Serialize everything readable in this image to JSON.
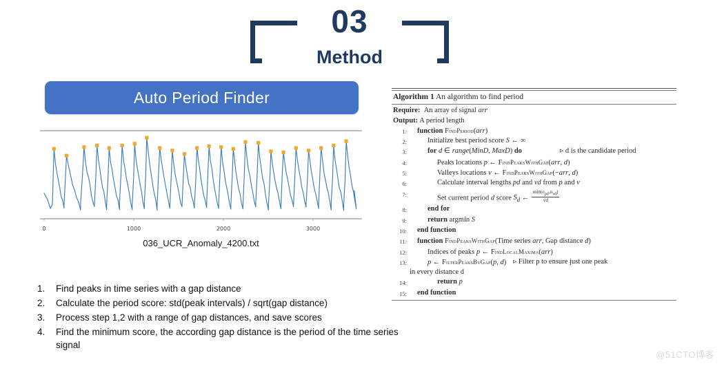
{
  "header": {
    "number": "03",
    "title": "Method"
  },
  "banner": {
    "label": "Auto Period Finder"
  },
  "chart_data": {
    "type": "line",
    "title": "",
    "caption": "036_UCR_Anomaly_4200.txt",
    "xlabel": "",
    "ylabel": "",
    "xlim": [
      0,
      3500
    ],
    "ylim": [
      0,
      1
    ],
    "grid": false,
    "legend": "none",
    "line_color": "#3d7eb8",
    "peak_marker_color": "#f0a830",
    "xticks": [
      0,
      1000,
      2000,
      3000
    ],
    "xticklabels": [
      "0",
      "1000",
      "2000",
      "3000"
    ],
    "series": [
      {
        "name": "signal",
        "description": "quasi-periodic sawtooth-like time series with sharp rising edges and slow decay",
        "period_estimate": 135,
        "peaks_x": [
          110,
          250,
          445,
          590,
          725,
          870,
          1010,
          1145,
          1290,
          1430,
          1565,
          1705,
          1840,
          1975,
          2110,
          2245,
          2390,
          2530,
          2670,
          2810,
          2950,
          3090,
          3230,
          3370
        ],
        "peaks_y": [
          0.82,
          0.74,
          0.84,
          0.86,
          0.83,
          0.86,
          0.88,
          0.95,
          0.83,
          0.8,
          0.76,
          0.83,
          0.85,
          0.84,
          0.82,
          0.9,
          0.89,
          0.79,
          0.78,
          0.83,
          0.8,
          0.83,
          0.86,
          0.91
        ]
      }
    ]
  },
  "steps": [
    {
      "num": "1.",
      "text": "Find peaks in time series with a gap distance"
    },
    {
      "num": "2.",
      "text": "Calculate the period score: std(peak intervals) / sqrt(gap distance)"
    },
    {
      "num": "3.",
      "text": "Process step 1,2 with a range of gap distances, and save scores"
    },
    {
      "num": "4.",
      "text": "Find the minimum  score, the according gap distance is the period of the time series signal"
    }
  ],
  "algorithm": {
    "title_label": "Algorithm 1",
    "title_text": "An algorithm to find period",
    "require_label": "Require:",
    "require_text": "An array of signal arr",
    "output_label": "Output:",
    "output_text": "A period length",
    "lines": [
      {
        "num": "1:",
        "text": "function FINDPERIOD(arr)"
      },
      {
        "num": "2:",
        "text": "Initialize best period score S ← ∞"
      },
      {
        "num": "3:",
        "text": "for d ∈ range(MinD, MaxD) do",
        "comment": "▹ d is the candidate period"
      },
      {
        "num": "4:",
        "text": "Peaks locations p ← FINDPEAKSWITHGAP(arr, d)"
      },
      {
        "num": "5:",
        "text": "Valleys locations v ← FINDPEAKSWITHGAP(−arr, d)"
      },
      {
        "num": "6:",
        "text": "Calculate interval lengths pd and vd from p and v"
      },
      {
        "num": "7:",
        "text": "Set current period d score S_d ← min(σpd, σvd)/√d"
      },
      {
        "num": "8:",
        "text": "end for"
      },
      {
        "num": "9:",
        "text": "return argmin S"
      },
      {
        "num": "10:",
        "text": "end function"
      },
      {
        "num": "11:",
        "text": "function FINDPEAKSWITHGAP(Time series arr, Gap distance d)"
      },
      {
        "num": "12:",
        "text": "Indices of peaks p ← FINDLOCALMAXIMA(arr)"
      },
      {
        "num": "13:",
        "text": "p ← FILTERPEAKSBYGAP(p, d)",
        "comment": "▹ Filter p to ensure just one peak",
        "continuation": "in every distance d"
      },
      {
        "num": "14:",
        "text": "return p"
      },
      {
        "num": "15:",
        "text": "end function"
      }
    ]
  },
  "watermark": {
    "text": "@51CTO博客"
  }
}
